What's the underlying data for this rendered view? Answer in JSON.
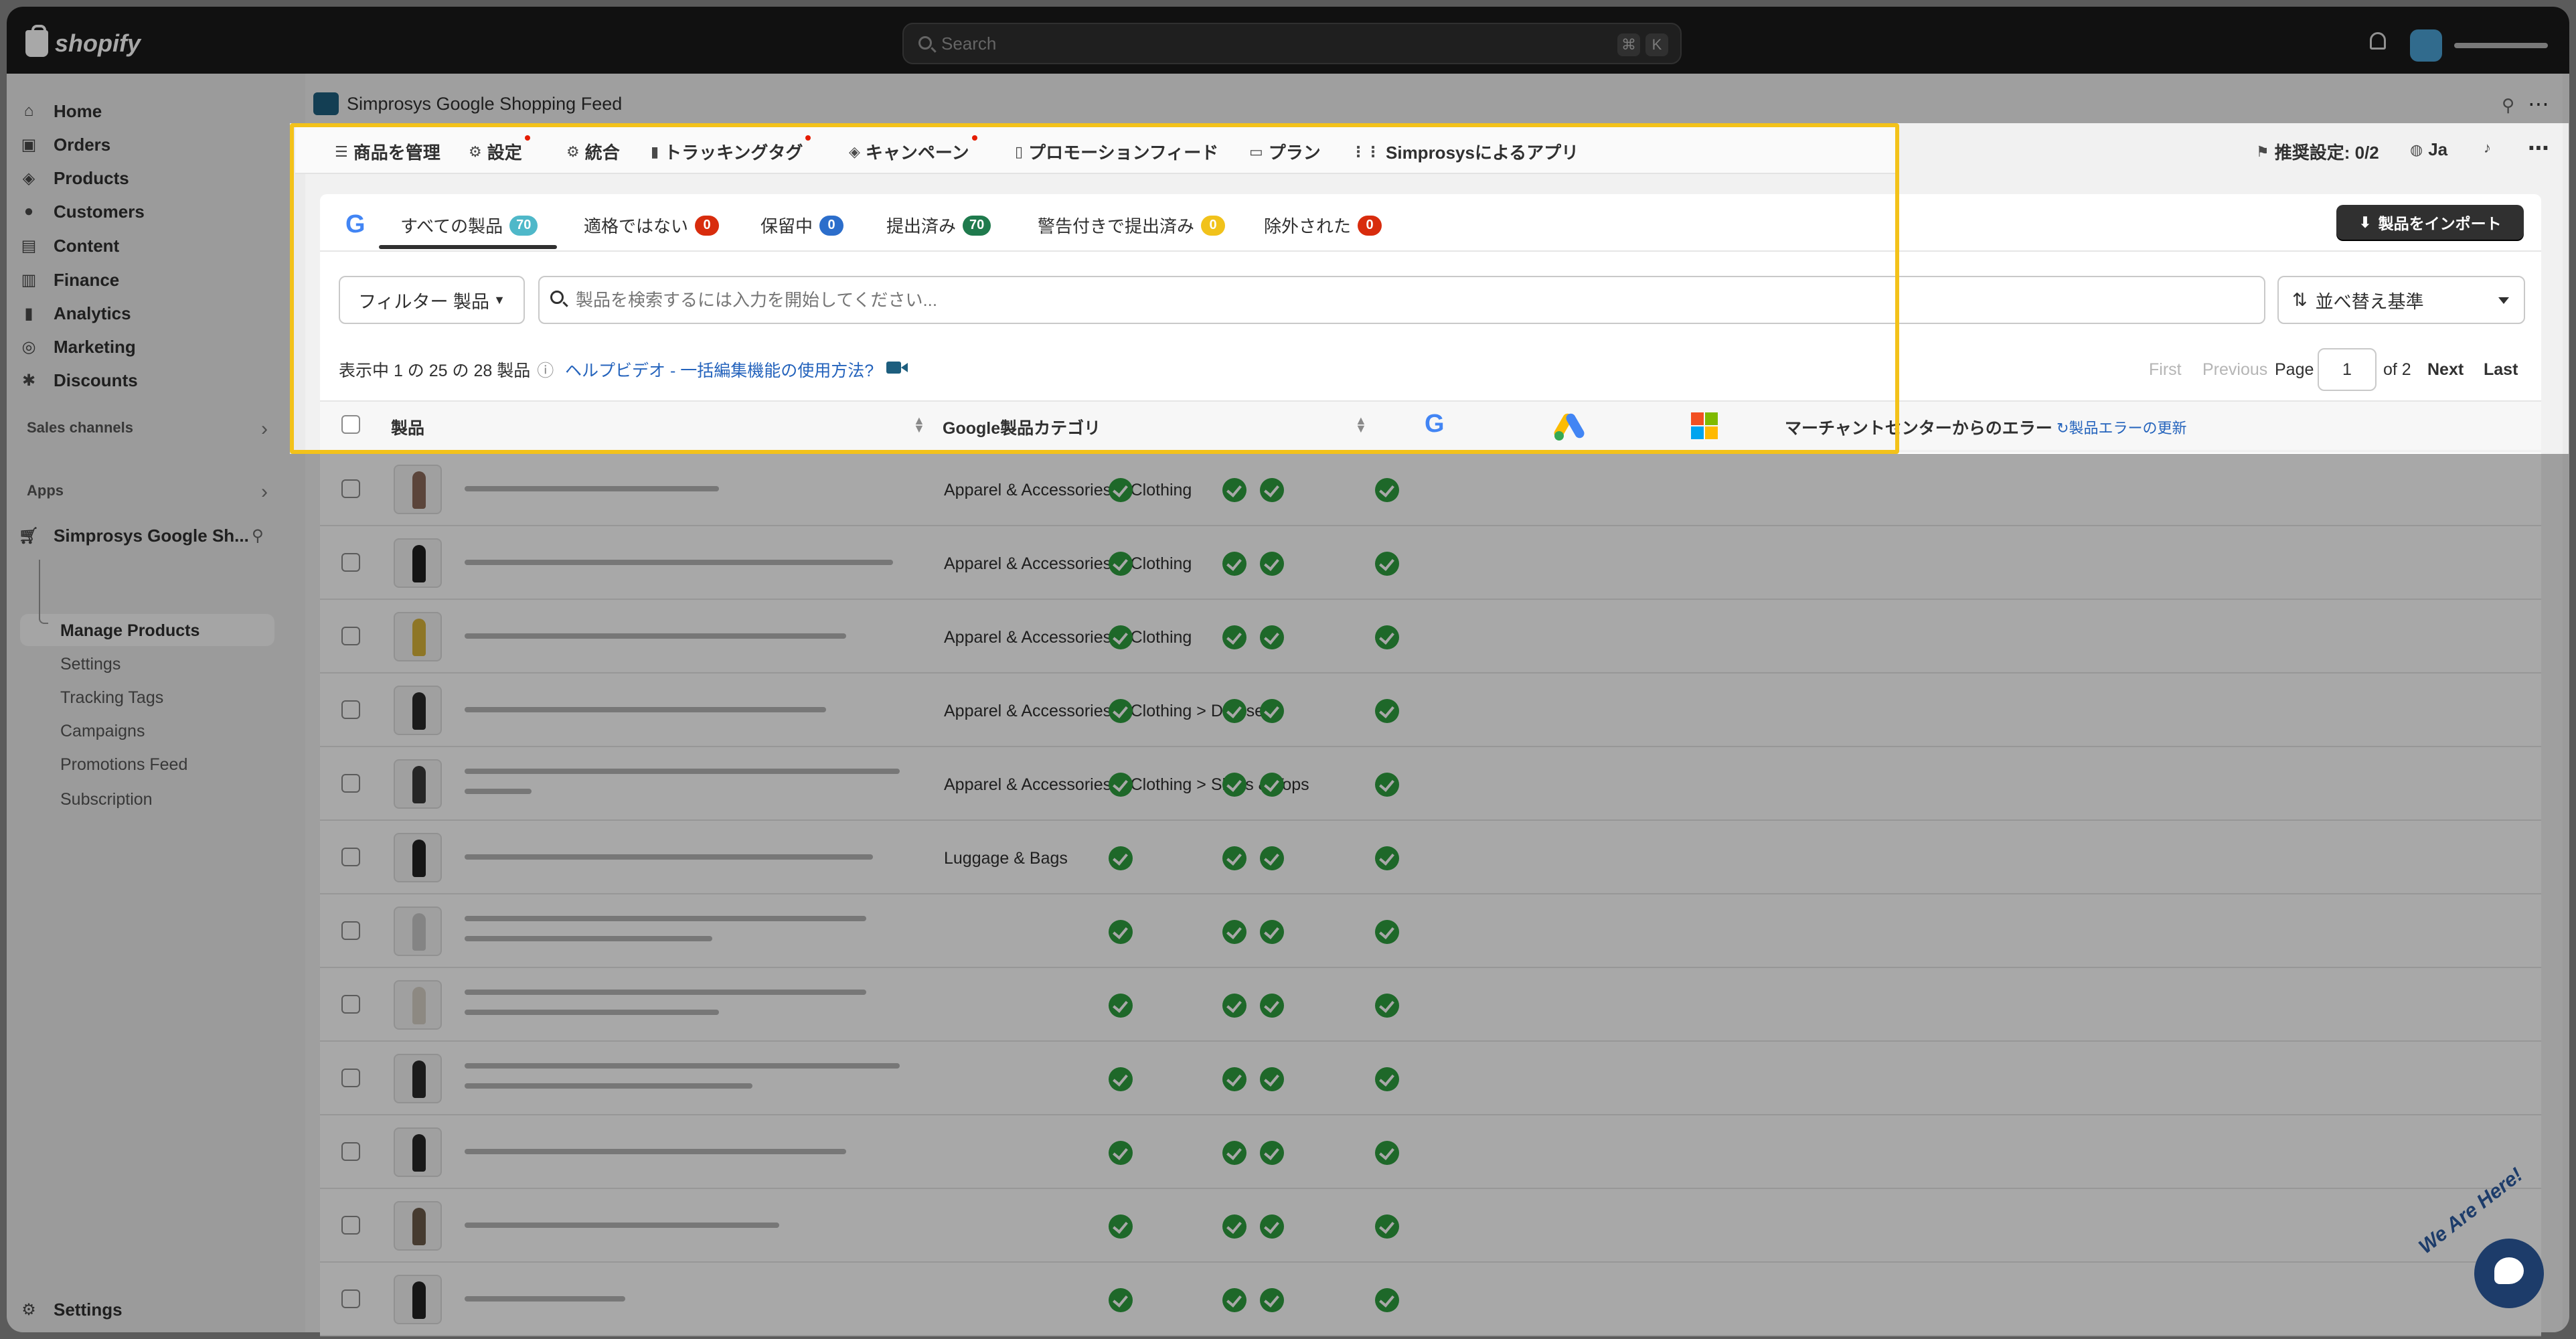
{
  "topbar": {
    "logo_text": "shopify",
    "search_placeholder": "Search",
    "shortcut_key1": "⌘",
    "shortcut_key2": "K"
  },
  "sidebar": {
    "items": [
      {
        "label": "Home",
        "icon": "home-icon"
      },
      {
        "label": "Orders",
        "icon": "orders-icon"
      },
      {
        "label": "Products",
        "icon": "tag-icon"
      },
      {
        "label": "Customers",
        "icon": "person-icon"
      },
      {
        "label": "Content",
        "icon": "content-icon"
      },
      {
        "label": "Finance",
        "icon": "bank-icon"
      },
      {
        "label": "Analytics",
        "icon": "bar-chart-icon"
      },
      {
        "label": "Marketing",
        "icon": "target-icon"
      },
      {
        "label": "Discounts",
        "icon": "percent-icon"
      }
    ],
    "sales_channels_heading": "Sales channels",
    "apps_heading": "Apps",
    "app_name": "Simprosys Google Sh...",
    "app_subitems": [
      "Manage Products",
      "Settings",
      "Tracking Tags",
      "Campaigns",
      "Promotions Feed",
      "Subscription"
    ],
    "settings_label": "Settings"
  },
  "app": {
    "title": "Simprosys Google Shopping Feed"
  },
  "menu": {
    "items": [
      "商品を管理",
      "設定",
      "統合",
      "トラッキングタグ",
      "キャンペーン",
      "プロモーションフィード",
      "プラン",
      "Simprosysによるアプリ"
    ],
    "recommended": "推奨設定: 0/2",
    "language": "Ja"
  },
  "tabs": [
    {
      "label": "すべての製品",
      "count": "70",
      "color": "#4fb8c9"
    },
    {
      "label": "適格ではない",
      "count": "0",
      "color": "#d82c0d"
    },
    {
      "label": "保留中",
      "count": "0",
      "color": "#2c6ecb"
    },
    {
      "label": "提出済み",
      "count": "70",
      "color": "#1f7a4d"
    },
    {
      "label": "警告付きで提出済み",
      "count": "0",
      "color": "#f1c21b"
    },
    {
      "label": "除外された",
      "count": "0",
      "color": "#d82c0d"
    }
  ],
  "import_button": "製品をインポート",
  "filter_button": "フィルター 製品",
  "search_placeholder": "製品を検索するには入力を開始してください...",
  "sort_button": "並べ替え基準",
  "showing_text": "表示中 1 の 25 の 28 製品",
  "help_link": "ヘルプビデオ - 一括編集機能の使用方法?",
  "pagination": {
    "first": "First",
    "previous": "Previous",
    "page_label": "Page",
    "page_value": "1",
    "of": "of 2",
    "next": "Next",
    "last": "Last"
  },
  "table": {
    "col_product": "製品",
    "col_category": "Google製品カテゴリ",
    "col_errors": "マーチャントセンターからのエラー",
    "refresh_errors": "製品エラーの更新",
    "rows": [
      {
        "category": "Apparel & Accessories > Clothing"
      },
      {
        "category": "Apparel & Accessories > Clothing"
      },
      {
        "category": "Apparel & Accessories > Clothing"
      },
      {
        "category": "Apparel & Accessories > Clothing > Dresses"
      },
      {
        "category": "Apparel & Accessories > Clothing > Shirts & Tops"
      },
      {
        "category": "Luggage & Bags"
      },
      {
        "category": ""
      },
      {
        "category": ""
      },
      {
        "category": ""
      },
      {
        "category": ""
      },
      {
        "category": ""
      },
      {
        "category": ""
      }
    ]
  },
  "chat_widget_text": "We Are Here!",
  "colors": {
    "highlight": "#f3c21a",
    "success": "#2e9e3f",
    "link": "#2463bc"
  }
}
